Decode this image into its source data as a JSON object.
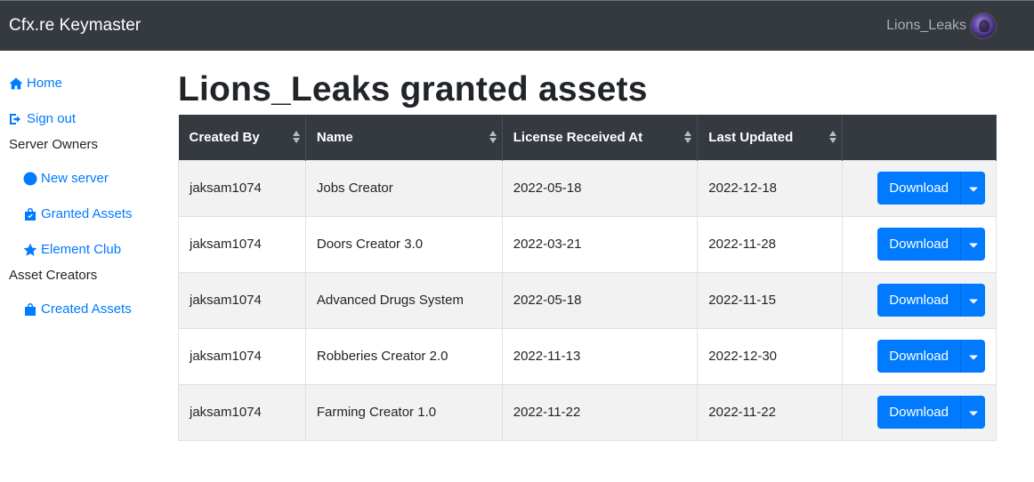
{
  "app": {
    "brand": "Cfx.re Keymaster",
    "username": "Lions_Leaks"
  },
  "sidebar": {
    "home": "Home",
    "sign_out": "Sign out",
    "server_owners_heading": "Server Owners",
    "new_server": "New server",
    "granted_assets": "Granted Assets",
    "element_club": "Element Club",
    "asset_creators_heading": "Asset Creators",
    "created_assets": "Created Assets"
  },
  "main": {
    "title": "Lions_Leaks granted assets",
    "columns": [
      "Created By",
      "Name",
      "License Received At",
      "Last Updated"
    ],
    "download_label": "Download",
    "rows": [
      {
        "created_by": "jaksam1074",
        "name": "Jobs Creator",
        "received": "2022-05-18",
        "updated": "2022-12-18"
      },
      {
        "created_by": "jaksam1074",
        "name": "Doors Creator 3.0",
        "received": "2022-03-21",
        "updated": "2022-11-28"
      },
      {
        "created_by": "jaksam1074",
        "name": "Advanced Drugs System",
        "received": "2022-05-18",
        "updated": "2022-11-15"
      },
      {
        "created_by": "jaksam1074",
        "name": "Robberies Creator 2.0",
        "received": "2022-11-13",
        "updated": "2022-12-30"
      },
      {
        "created_by": "jaksam1074",
        "name": "Farming Creator 1.0",
        "received": "2022-11-22",
        "updated": "2022-11-22"
      }
    ]
  },
  "colors": {
    "navbar": "#343a40",
    "link": "#007bff",
    "button": "#007bff"
  },
  "icons": [
    "home-icon",
    "sign-out-icon",
    "globe-icon",
    "shopping-bag-icon",
    "star-icon",
    "shopping-bag-icon",
    "sort-icon",
    "caret-down-icon"
  ]
}
